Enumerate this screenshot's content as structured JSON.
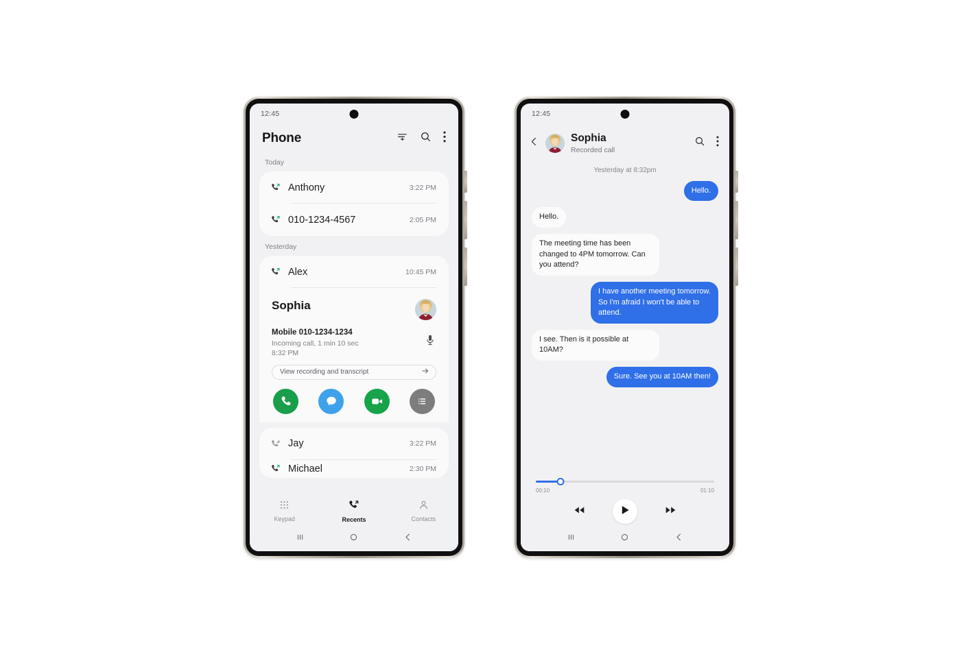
{
  "colors": {
    "accent_blue": "#2f6fe8",
    "call_green": "#1a9e4b",
    "message_blue": "#3ea2ea",
    "video_green": "#16a34a",
    "list_gray": "#7d7d7d",
    "screen_bg": "#f1f1f3",
    "card_bg": "#fafafa"
  },
  "phone_left": {
    "status": {
      "clock": "12:45"
    },
    "header": {
      "title": "Phone",
      "icons": [
        {
          "name": "sort-icon",
          "label": "Sort"
        },
        {
          "name": "search-icon",
          "label": "Search"
        },
        {
          "name": "more-options-icon",
          "label": "More options"
        }
      ]
    },
    "sections": [
      {
        "label": "Today",
        "calls": [
          {
            "name": "Anthony",
            "time": "3:22 PM",
            "type": "outgoing"
          },
          {
            "name": "010-1234-4567",
            "time": "2:05 PM",
            "type": "outgoing"
          }
        ]
      },
      {
        "label": "Yesterday",
        "calls": [
          {
            "name": "Alex",
            "time": "10:45 PM",
            "type": "outgoing"
          }
        ]
      }
    ],
    "expanded_contact": {
      "name": "Sophia",
      "mobile": "Mobile 010-1234-1234",
      "call_info": "Incoming call, 1 min 10 sec",
      "call_time": "8:32 PM",
      "transcript_button": "View recording and transcript",
      "mic_icon": "microphone-icon",
      "actions": [
        {
          "name": "call-action",
          "icon": "phone-icon",
          "color": "#1a9e4b"
        },
        {
          "name": "message-action",
          "icon": "message-icon",
          "color": "#3ea2ea"
        },
        {
          "name": "video-call-action",
          "icon": "video-camera-icon",
          "color": "#16a34a"
        },
        {
          "name": "details-action",
          "icon": "list-icon",
          "color": "#7d7d7d"
        }
      ]
    },
    "more_calls": [
      {
        "name": "Jay",
        "time": "3:22 PM",
        "type": "missed"
      },
      {
        "name": "Michael",
        "time": "2:30 PM",
        "type": "outgoing"
      }
    ],
    "bottom_nav": [
      {
        "label": "Keypad",
        "icon": "keypad-icon",
        "active": false
      },
      {
        "label": "Recents",
        "icon": "recents-icon",
        "active": true
      },
      {
        "label": "Contacts",
        "icon": "contacts-icon",
        "active": false
      }
    ],
    "gesture_bar": [
      {
        "name": "recents-nav-icon"
      },
      {
        "name": "home-nav-icon"
      },
      {
        "name": "back-nav-icon"
      }
    ]
  },
  "phone_right": {
    "status": {
      "clock": "12:45"
    },
    "header": {
      "back_icon": "back-chevron-icon",
      "avatar": "contact-avatar",
      "name": "Sophia",
      "subtitle": "Recorded call",
      "icons": [
        {
          "name": "search-icon",
          "label": "Search"
        },
        {
          "name": "more-options-icon",
          "label": "More options"
        }
      ]
    },
    "daystamp": "Yesterday at 8:32pm",
    "messages": [
      {
        "side": "out",
        "text": "Hello."
      },
      {
        "side": "in",
        "text": "Hello."
      },
      {
        "side": "in",
        "text": "The meeting time has been changed to 4PM tomorrow. Can you attend?"
      },
      {
        "side": "out",
        "text": "I have another meeting tomorrow. So I'm afraid I won't be able to attend."
      },
      {
        "side": "in",
        "text": "I see. Then is it possible at 10AM?"
      },
      {
        "side": "out",
        "text": "Sure. See you at 10AM then!"
      }
    ],
    "player": {
      "elapsed": "00:10",
      "duration": "01:10",
      "progress_percent": 14,
      "controls": [
        {
          "name": "rewind-button",
          "icon": "rewind-icon"
        },
        {
          "name": "play-button",
          "icon": "play-icon"
        },
        {
          "name": "fast-forward-button",
          "icon": "fast-forward-icon"
        }
      ]
    },
    "gesture_bar": [
      {
        "name": "recents-nav-icon"
      },
      {
        "name": "home-nav-icon"
      },
      {
        "name": "back-nav-icon"
      }
    ]
  }
}
